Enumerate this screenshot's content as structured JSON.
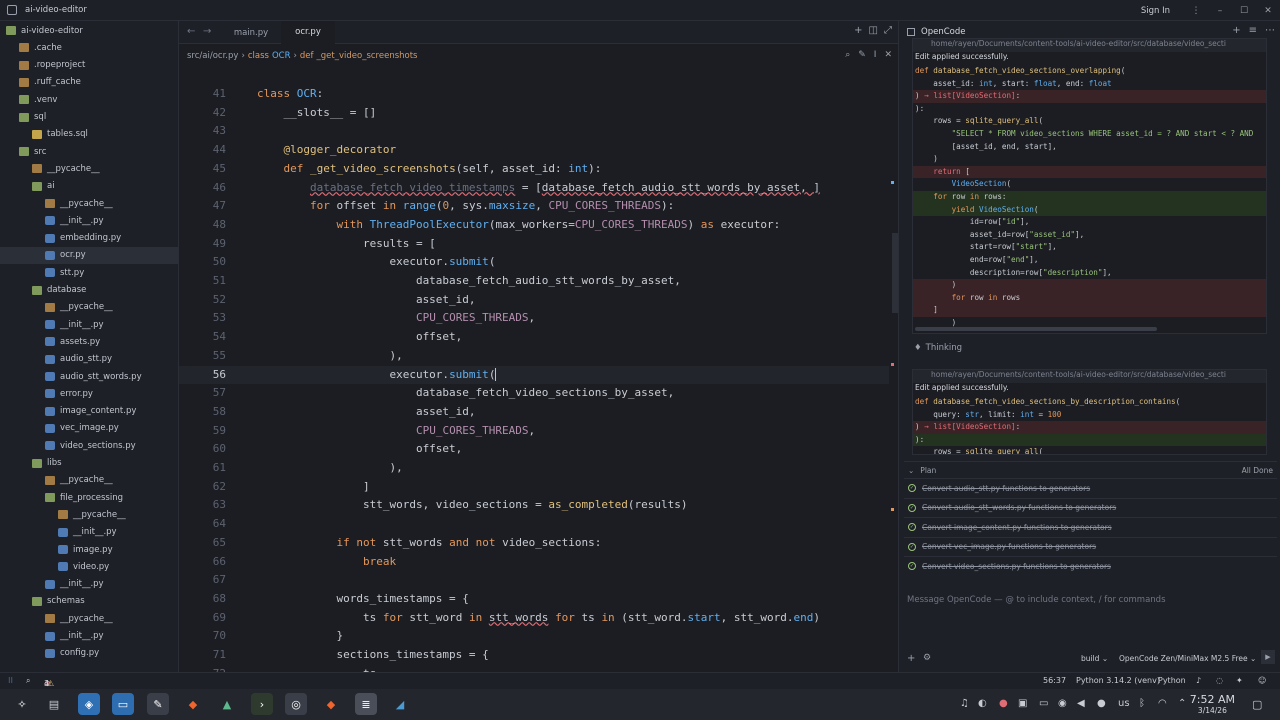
{
  "window": {
    "title": "ai-video-editor",
    "signin": "Sign In"
  },
  "sidebar": {
    "items": [
      {
        "label": "ai-video-editor",
        "depth": 0,
        "icon": "folder-open",
        "chev": "⌄"
      },
      {
        "label": ".cache",
        "depth": 1,
        "icon": "folder"
      },
      {
        "label": ".ropeproject",
        "depth": 1,
        "icon": "folder"
      },
      {
        "label": ".ruff_cache",
        "depth": 1,
        "icon": "folder"
      },
      {
        "label": ".venv",
        "depth": 1,
        "icon": "folder-open"
      },
      {
        "label": "sql",
        "depth": 1,
        "icon": "folder-open",
        "chev": "⌄"
      },
      {
        "label": "tables.sql",
        "depth": 2,
        "icon": "sql"
      },
      {
        "label": "src",
        "depth": 1,
        "icon": "folder-open",
        "chev": "⌄"
      },
      {
        "label": "__pycache__",
        "depth": 2,
        "icon": "folder"
      },
      {
        "label": "ai",
        "depth": 2,
        "icon": "folder-open",
        "chev": "⌄"
      },
      {
        "label": "__pycache__",
        "depth": 3,
        "icon": "folder"
      },
      {
        "label": "__init__.py",
        "depth": 3,
        "icon": "py"
      },
      {
        "label": "embedding.py",
        "depth": 3,
        "icon": "py"
      },
      {
        "label": "ocr.py",
        "depth": 3,
        "icon": "py",
        "selected": true
      },
      {
        "label": "stt.py",
        "depth": 3,
        "icon": "py"
      },
      {
        "label": "database",
        "depth": 2,
        "icon": "folder-open",
        "chev": "⌄"
      },
      {
        "label": "__pycache__",
        "depth": 3,
        "icon": "folder"
      },
      {
        "label": "__init__.py",
        "depth": 3,
        "icon": "py"
      },
      {
        "label": "assets.py",
        "depth": 3,
        "icon": "py"
      },
      {
        "label": "audio_stt.py",
        "depth": 3,
        "icon": "py"
      },
      {
        "label": "audio_stt_words.py",
        "depth": 3,
        "icon": "py"
      },
      {
        "label": "error.py",
        "depth": 3,
        "icon": "py"
      },
      {
        "label": "image_content.py",
        "depth": 3,
        "icon": "py"
      },
      {
        "label": "vec_image.py",
        "depth": 3,
        "icon": "py"
      },
      {
        "label": "video_sections.py",
        "depth": 3,
        "icon": "py"
      },
      {
        "label": "libs",
        "depth": 2,
        "icon": "folder-open",
        "chev": "⌄"
      },
      {
        "label": "__pycache__",
        "depth": 3,
        "icon": "folder"
      },
      {
        "label": "file_processing",
        "depth": 3,
        "icon": "folder-open",
        "chev": "⌄"
      },
      {
        "label": "__pycache__",
        "depth": 4,
        "icon": "folder"
      },
      {
        "label": "__init__.py",
        "depth": 4,
        "icon": "py"
      },
      {
        "label": "image.py",
        "depth": 4,
        "icon": "py"
      },
      {
        "label": "video.py",
        "depth": 4,
        "icon": "py"
      },
      {
        "label": "__init__.py",
        "depth": 3,
        "icon": "py"
      },
      {
        "label": "schemas",
        "depth": 2,
        "icon": "folder-open",
        "chev": "⌄"
      },
      {
        "label": "__pycache__",
        "depth": 3,
        "icon": "folder"
      },
      {
        "label": "__init__.py",
        "depth": 3,
        "icon": "py"
      },
      {
        "label": "config.py",
        "depth": 3,
        "icon": "py"
      }
    ]
  },
  "editor": {
    "tabs": [
      {
        "label": "main.py",
        "active": false
      },
      {
        "label": "ocr.py",
        "active": true
      }
    ],
    "breadcrumb": {
      "path": "src/ai/ocr.py",
      "sep": "›",
      "kw_class": "class",
      "class_name": "OCR",
      "kw_def": "def",
      "func": "_get_video_screenshots"
    },
    "current_line": 56,
    "lines": [
      {
        "n": "41",
        "html": "<span class='k'>class</span> <span class='c'>OCR</span>:"
      },
      {
        "n": "42",
        "html": "    __slots__ = []"
      },
      {
        "n": "43",
        "html": ""
      },
      {
        "n": "44",
        "html": "    <span class='f'>@logger_decorator</span>"
      },
      {
        "n": "45",
        "html": "    <span class='k'>def</span> <span class='f'>_get_video_screenshots</span>(self, asset_id: <span class='c'>int</span>):"
      },
      {
        "n": "46",
        "html": "        <span class='ghost err'>database_fetch_video_timestamps</span> = [<span class='err'>database_fetch_audio_stt_words_by_asset, ]</span>"
      },
      {
        "n": "47",
        "html": "        <span class='k'>for</span> offset <span class='k'>in</span> <span class='c'>range</span>(<span class='a'>0</span>, sys.<span class='c'>maxsize</span>, <span class='p'>CPU_CORES_THREADS</span>):"
      },
      {
        "n": "48",
        "html": "            <span class='k'>with</span> <span class='c'>ThreadPoolExecutor</span>(max_workers=<span class='p'>CPU_CORES_THREADS</span>) <span class='k'>as</span> executor:"
      },
      {
        "n": "49",
        "html": "                results = ["
      },
      {
        "n": "50",
        "html": "                    executor.<span class='c'>submit</span>("
      },
      {
        "n": "51",
        "html": "                        database_fetch_audio_stt_words_by_asset,"
      },
      {
        "n": "52",
        "html": "                        asset_id,"
      },
      {
        "n": "53",
        "html": "                        <span class='p'>CPU_CORES_THREADS</span>,"
      },
      {
        "n": "54",
        "html": "                        offset,"
      },
      {
        "n": "55",
        "html": "                    ),"
      },
      {
        "n": "56",
        "html": "                    executor.<span class='c'>submit</span>(<span style='border-left:1px solid #e0c07d'></span>"
      },
      {
        "n": "57",
        "html": "                        database_fetch_video_sections_by_asset,"
      },
      {
        "n": "58",
        "html": "                        asset_id,"
      },
      {
        "n": "59",
        "html": "                        <span class='p'>CPU_CORES_THREADS</span>,"
      },
      {
        "n": "60",
        "html": "                        offset,"
      },
      {
        "n": "61",
        "html": "                    ),"
      },
      {
        "n": "62",
        "html": "                ]"
      },
      {
        "n": "63",
        "html": "                stt_words, video_sections = <span class='f'>as_completed</span>(results)"
      },
      {
        "n": "64",
        "html": ""
      },
      {
        "n": "65",
        "html": "            <span class='k'>if not</span> stt_words <span class='k'>and not</span> video_sections:"
      },
      {
        "n": "66",
        "html": "                <span class='k'>break</span>"
      },
      {
        "n": "67",
        "html": ""
      },
      {
        "n": "68",
        "html": "            words_timestamps = {"
      },
      {
        "n": "69",
        "html": "                ts <span class='k'>for</span> stt_word <span class='k'>in</span> <span class='err'>stt_words</span> <span class='k'>for</span> ts <span class='k'>in</span> (stt_word.<span class='c'>start</span>, stt_word.<span class='c'>end</span>)"
      },
      {
        "n": "70",
        "html": "            }"
      },
      {
        "n": "71",
        "html": "            sections_timestamps = {"
      },
      {
        "n": "72",
        "html": "                ts"
      }
    ]
  },
  "panel": {
    "title": "OpenCode",
    "card1": {
      "path": "home/rayen/Documents/content-tools/ai-video-editor/src/database/video_secti",
      "status": "Edit applied successfully.",
      "lines": [
        {
          "t": "",
          "html": "<span class='kw'>def</span> <span class='fnm'>database_fetch_video_sections_overlapping</span>("
        },
        {
          "t": "",
          "html": "    asset_id: <span class='ty'>int</span>, start: <span class='ty'>float</span>, end: <span class='ty'>float</span>"
        },
        {
          "t": "rm",
          "html": ") <span class='red'>→</span> <span class='red'>list[VideoSection]</span>:"
        },
        {
          "t": "",
          "html": "):"
        },
        {
          "t": "",
          "html": "    rows = <span class='fnm'>sqlite_query_all</span>("
        },
        {
          "t": "",
          "html": "        <span class='str'>\"SELECT * FROM video_sections WHERE asset_id = ? AND start < ? AND</span>"
        },
        {
          "t": "",
          "html": "        [asset_id, end, start],"
        },
        {
          "t": "",
          "html": "    )"
        },
        {
          "t": "rm",
          "html": "    <span class='red'>return</span> ["
        },
        {
          "t": "",
          "html": "        <span class='ty'>VideoSection</span>("
        },
        {
          "t": "add",
          "html": "    <span class='kw'>for</span> row <span class='kw'>in</span> rows:"
        },
        {
          "t": "add",
          "html": "        <span class='kw'>yield</span> <span class='ty'>VideoSection</span>("
        },
        {
          "t": "",
          "html": "            id=row[<span class='str'>\"id\"</span>],"
        },
        {
          "t": "",
          "html": "            asset_id=row[<span class='str'>\"asset_id\"</span>],"
        },
        {
          "t": "",
          "html": "            start=row[<span class='str'>\"start\"</span>],"
        },
        {
          "t": "",
          "html": "            end=row[<span class='str'>\"end\"</span>],"
        },
        {
          "t": "",
          "html": "            description=row[<span class='str'>\"description\"</span>],"
        },
        {
          "t": "rm",
          "html": "        )"
        },
        {
          "t": "rm",
          "html": "        <span class='kw'>for</span> row <span class='kw'>in</span> rows"
        },
        {
          "t": "rm",
          "html": "    ]"
        },
        {
          "t": "",
          "html": "        )"
        }
      ]
    },
    "thinking": "Thinking",
    "card2": {
      "path": "home/rayen/Documents/content-tools/ai-video-editor/src/database/video_secti",
      "status": "Edit applied successfully.",
      "lines": [
        {
          "t": "",
          "html": "<span class='kw'>def</span> <span class='fnm'>database_fetch_video_sections_by_description_contains</span>("
        },
        {
          "t": "",
          "html": "    query: <span class='ty'>str</span>, limit: <span class='ty'>int</span> = <span class='kw'>100</span>"
        },
        {
          "t": "rm",
          "html": ") <span class='red'>→</span> <span class='red'>list[VideoSection]</span>:"
        },
        {
          "t": "add",
          "html": "):"
        },
        {
          "t": "",
          "html": "    rows = <span class='fnm'>sqlite_query_all</span>("
        }
      ]
    },
    "plan": {
      "title": "Plan",
      "status": "All Done",
      "items": [
        "Convert audio_stt.py functions to generators",
        "Convert audio_stt_words.py functions to generators",
        "Convert image_content.py functions to generators",
        "Convert vec_image.py functions to generators",
        "Convert video_sections.py functions to generators"
      ]
    },
    "message_placeholder": "Message OpenCode — @ to include context, / for commands",
    "footer": {
      "mode": "build",
      "model": "OpenCode Zen/MiniMax M2.5 Free"
    }
  },
  "statusbar": {
    "errors": "4",
    "warnings": "3",
    "position": "56:37",
    "interpreter": "Python 3.14.2 (venv)",
    "language": "Python"
  },
  "taskbar": {
    "time": "7:52 AM",
    "date": "3/14/26",
    "keyboard": "us"
  }
}
